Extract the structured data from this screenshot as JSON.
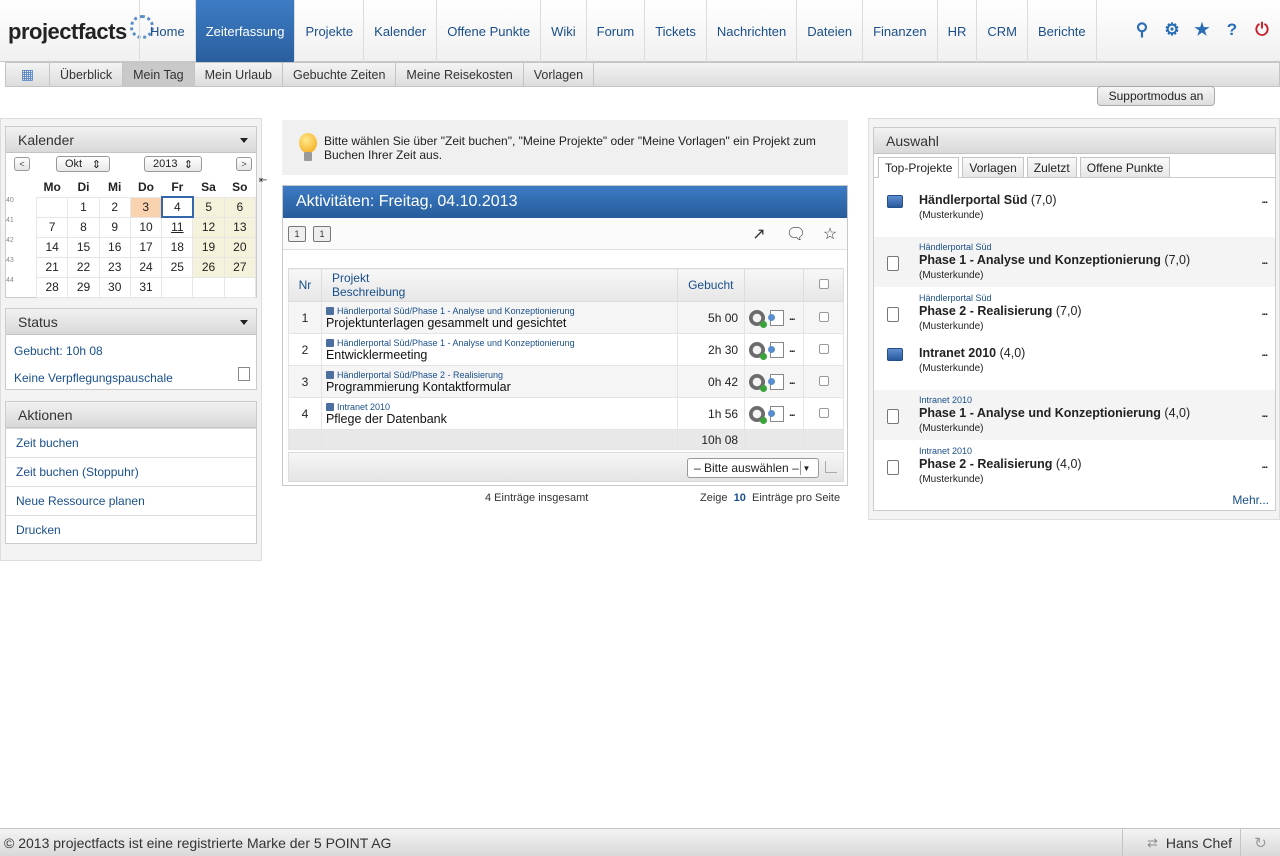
{
  "app": {
    "logo": "projectfacts"
  },
  "nav": {
    "items": [
      "Home",
      "Zeiterfassung",
      "Projekte",
      "Kalender",
      "Offene Punkte",
      "Wiki",
      "Forum",
      "Tickets",
      "Nachrichten",
      "Dateien",
      "Finanzen",
      "HR",
      "CRM",
      "Berichte"
    ],
    "active": "Zeiterfassung"
  },
  "subnav": {
    "items": [
      "Überblick",
      "Mein Tag",
      "Mein Urlaub",
      "Gebuchte Zeiten",
      "Meine Reisekosten",
      "Vorlagen"
    ],
    "active": "Mein Tag"
  },
  "support": {
    "label": "Supportmodus an"
  },
  "calendar": {
    "title": "Kalender",
    "prev": "<",
    "next": ">",
    "month": "Okt",
    "year": "2013",
    "weekdays": [
      "Mo",
      "Di",
      "Mi",
      "Do",
      "Fr",
      "Sa",
      "So"
    ],
    "weeks": [
      {
        "wk": "40",
        "days": [
          "",
          "1",
          "2",
          "3",
          "4",
          "5",
          "6"
        ]
      },
      {
        "wk": "41",
        "days": [
          "7",
          "8",
          "9",
          "10",
          "11",
          "12",
          "13"
        ]
      },
      {
        "wk": "42",
        "days": [
          "14",
          "15",
          "16",
          "17",
          "18",
          "19",
          "20"
        ]
      },
      {
        "wk": "43",
        "days": [
          "21",
          "22",
          "23",
          "24",
          "25",
          "26",
          "27"
        ]
      },
      {
        "wk": "44",
        "days": [
          "28",
          "29",
          "30",
          "31",
          "",
          "",
          ""
        ]
      }
    ],
    "selected": "4",
    "highlighted": "3",
    "underlined": "11"
  },
  "status": {
    "title": "Status",
    "booked": "Gebucht: 10h 08",
    "allowance": "Keine Verpflegungspauschale"
  },
  "actions": {
    "title": "Aktionen",
    "items": [
      "Zeit buchen",
      "Zeit buchen (Stoppuhr)",
      "Neue Ressource planen",
      "Drucken"
    ]
  },
  "hint": {
    "text": "Bitte wählen Sie über \"Zeit buchen\", \"Meine Projekte\" oder \"Meine Vorlagen\" ein Projekt zum Buchen Ihrer Zeit aus."
  },
  "activities": {
    "title": "Aktivitäten: Freitag, 04.10.2013",
    "columns": {
      "nr": "Nr",
      "project": "Projekt",
      "description": "Beschreibung",
      "booked": "Gebucht"
    },
    "rows": [
      {
        "nr": "1",
        "path": "Händlerportal Süd/Phase 1 - Analyse und Konzeptionierung",
        "desc": "Projektunterlagen gesammelt und gesichtet",
        "time": "5h 00"
      },
      {
        "nr": "2",
        "path": "Händlerportal Süd/Phase 1 - Analyse und Konzeptionierung",
        "desc": "Entwicklermeeting",
        "time": "2h 30"
      },
      {
        "nr": "3",
        "path": "Händlerportal Süd/Phase 2 - Realisierung",
        "desc": "Programmierung Kontaktformular",
        "time": "0h 42"
      },
      {
        "nr": "4",
        "path": "Intranet 2010",
        "desc": "Pflege der Datenbank",
        "time": "1h 56"
      }
    ],
    "total": "10h 08",
    "select": "– Bitte auswählen –",
    "count": "4 Einträge insgesamt",
    "per_page_prefix": "Zeige",
    "per_page": "10",
    "per_page_suffix": "Einträge pro Seite"
  },
  "selection": {
    "title": "Auswahl",
    "tabs": [
      "Top-Projekte",
      "Vorlagen",
      "Zuletzt",
      "Offene Punkte"
    ],
    "active_tab": "Top-Projekte",
    "items": [
      {
        "type": "folder",
        "parent": "",
        "title": "Händlerportal Süd",
        "hours": "(7,0)",
        "customer": "(Musterkunde)"
      },
      {
        "type": "doc",
        "parent": "Händlerportal Süd",
        "title": "Phase 1 - Analyse und Konzeptionierung",
        "hours": "(7,0)",
        "customer": "(Musterkunde)"
      },
      {
        "type": "doc",
        "parent": "Händlerportal Süd",
        "title": "Phase 2 - Realisierung",
        "hours": "(7,0)",
        "customer": "(Musterkunde)"
      },
      {
        "type": "folder",
        "parent": "",
        "title": "Intranet 2010",
        "hours": "(4,0)",
        "customer": "(Musterkunde)"
      },
      {
        "type": "doc",
        "parent": "Intranet 2010",
        "title": "Phase 1 - Analyse und Konzeptionierung",
        "hours": "(4,0)",
        "customer": "(Musterkunde)"
      },
      {
        "type": "doc",
        "parent": "Intranet 2010",
        "title": "Phase 2 - Realisierung",
        "hours": "(4,0)",
        "customer": "(Musterkunde)"
      }
    ],
    "more": "Mehr..."
  },
  "footer": {
    "copyright": "© 2013 projectfacts ist eine registrierte Marke der 5 POINT AG",
    "user": "Hans Chef"
  }
}
